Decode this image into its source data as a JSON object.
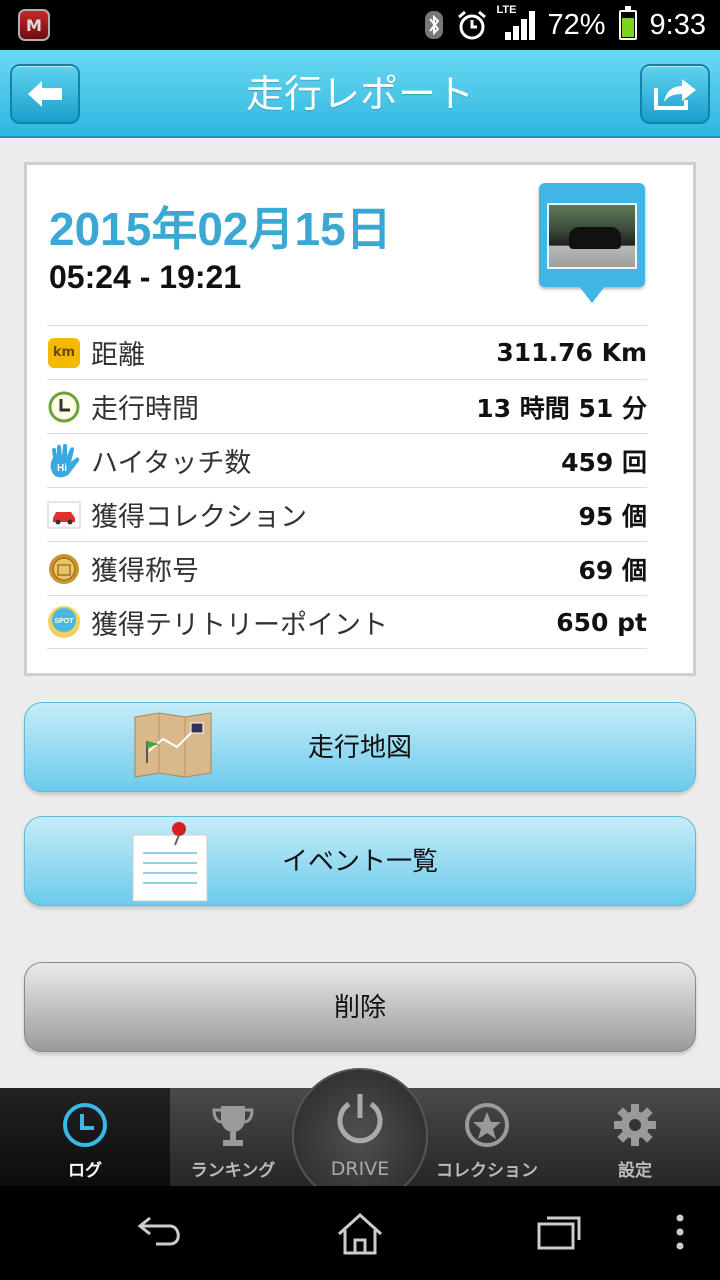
{
  "status_bar": {
    "app_icon_letter": "M",
    "network": "LTE",
    "battery": "72%",
    "battery_level": 0.72,
    "time": "9:33"
  },
  "header": {
    "title": "走行レポート",
    "back_icon": "back-arrow-icon",
    "share_icon": "share-icon"
  },
  "report": {
    "date": "2015年02月15日",
    "time_range": "05:24 - 19:21",
    "photo_icon": "car-photo-pin-icon",
    "stats": [
      {
        "icon": "km-icon",
        "label": "距離",
        "value": "311.76 Km"
      },
      {
        "icon": "clock-icon",
        "label": "走行時間",
        "value": "13 時間 51 分"
      },
      {
        "icon": "hi-five-icon",
        "label": "ハイタッチ数",
        "value": "459 回"
      },
      {
        "icon": "car-icon",
        "label": "獲得コレクション",
        "value": "95 個"
      },
      {
        "icon": "medal-icon",
        "label": "獲得称号",
        "value": "69 個"
      },
      {
        "icon": "spot-icon",
        "label": "獲得テリトリーポイント",
        "value": "650 pt"
      }
    ],
    "km_badge": "km",
    "hi_badge": "Hi",
    "spot_badge": "SPOT"
  },
  "buttons": {
    "map": "走行地図",
    "events": "イベント一覧",
    "delete": "削除"
  },
  "tabs": [
    {
      "label": "ログ",
      "icon": "clock-icon"
    },
    {
      "label": "ランキング",
      "icon": "trophy-icon"
    },
    {
      "label": "DRIVE",
      "icon": "power-icon"
    },
    {
      "label": "コレクション",
      "icon": "star-icon"
    },
    {
      "label": "設定",
      "icon": "gear-icon"
    }
  ],
  "colors": {
    "accent": "#3aa8d2",
    "header": "#2fb8e0"
  }
}
